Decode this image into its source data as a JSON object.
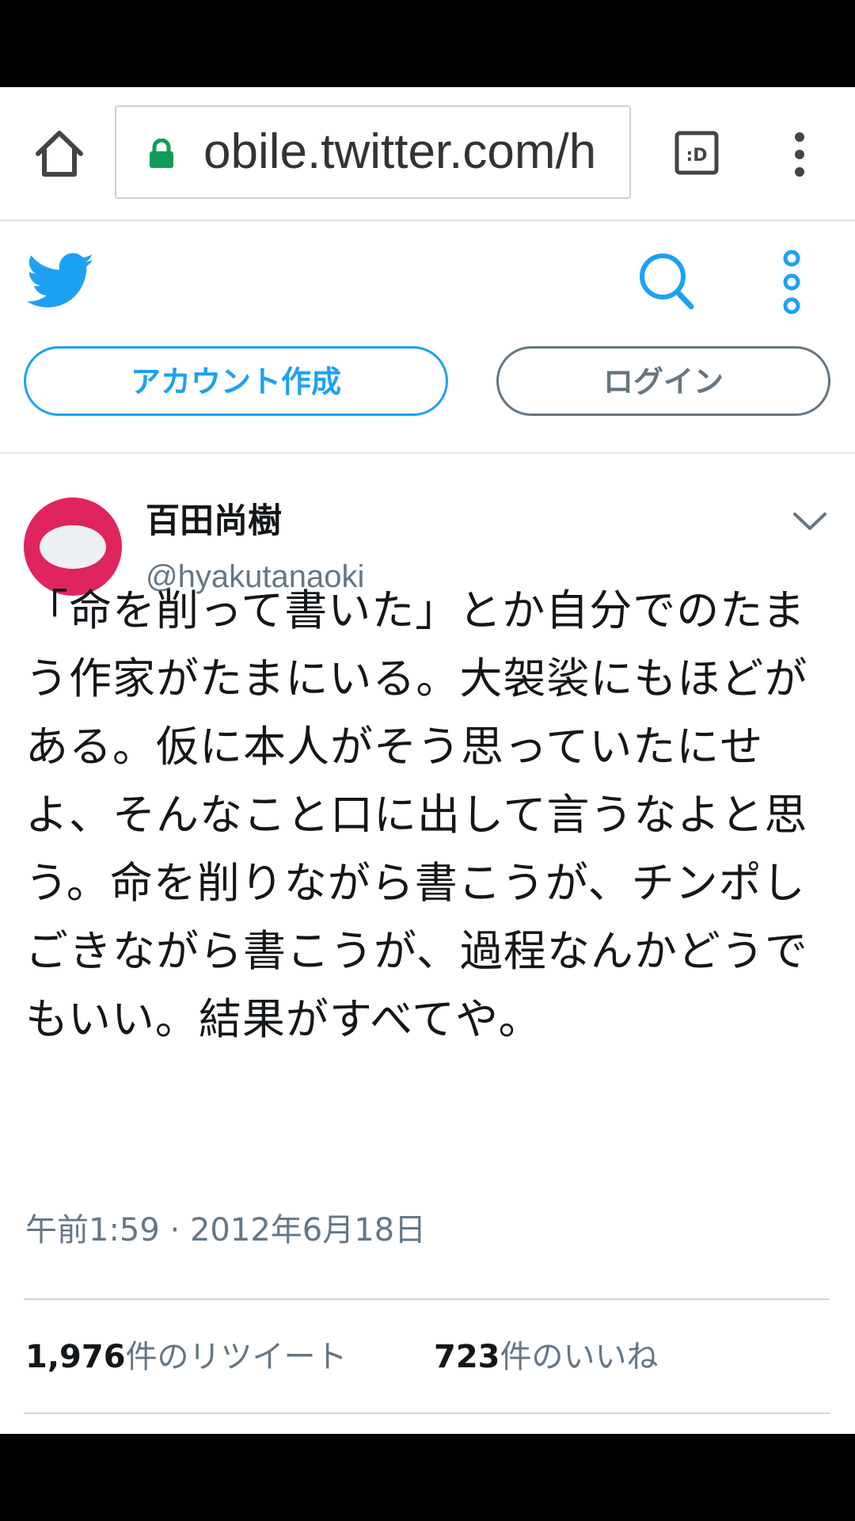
{
  "browser": {
    "url": "obile.twitter.com/h"
  },
  "header": {
    "signup_label": "アカウント作成",
    "login_label": "ログイン"
  },
  "tweet": {
    "display_name": "百田尚樹",
    "handle": "@hyakutanaoki",
    "text": "「命を削って書いた」とか自分でのたまう作家がたまにいる。大袈裟にもほどがある。仮に本人がそう思っていたにせよ、そんなこと口に出して言うなよと思う。命を削りながら書こうが、チンポしごきながら書こうが、過程なんかどうでもいい。結果がすべてや。",
    "timestamp": "午前1:59 · 2012年6月18日",
    "retweets": {
      "count": "1,976",
      "unit": "件の",
      "label": "リツイート"
    },
    "likes": {
      "count": "723",
      "unit": "件の",
      "label": "いいね"
    }
  },
  "colors": {
    "twitter_blue": "#1da1f2",
    "secondary_text": "#657786",
    "avatar": "#e0245e",
    "lock_green": "#0f9d58"
  },
  "icons": [
    "home-icon",
    "lock-icon",
    "tab-switcher-icon",
    "overflow-menu-icon",
    "twitter-bird-icon",
    "search-icon",
    "more-vertical-icon",
    "chevron-down-icon",
    "reply-icon",
    "retweet-icon",
    "like-icon",
    "direct-message-icon"
  ]
}
